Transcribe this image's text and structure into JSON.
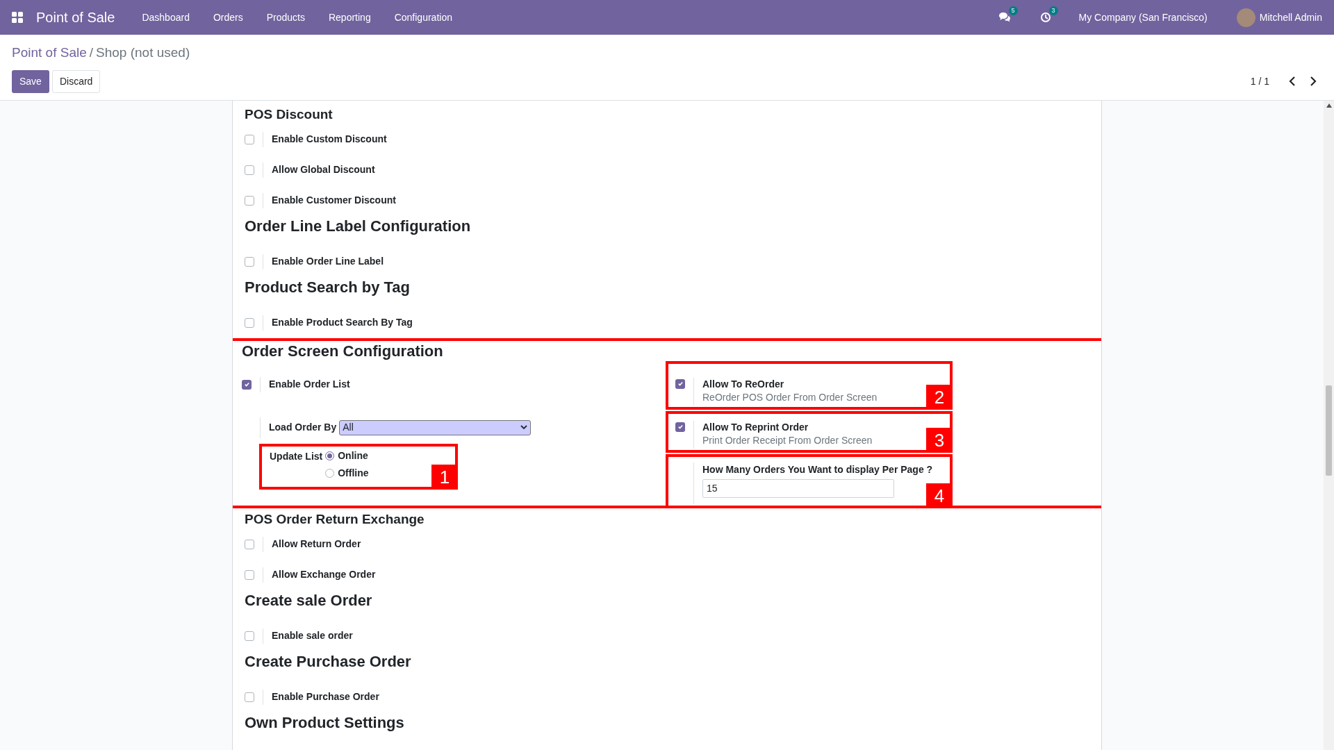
{
  "navbar": {
    "app_name": "Point of Sale",
    "menu": [
      "Dashboard",
      "Orders",
      "Products",
      "Reporting",
      "Configuration"
    ],
    "messages_count": "5",
    "activities_count": "3",
    "company": "My Company (San Francisco)",
    "user": "Mitchell Admin"
  },
  "breadcrumb": {
    "parent": "Point of Sale",
    "separator": "/",
    "current": "Shop (not used)"
  },
  "buttons": {
    "save": "Save",
    "discard": "Discard"
  },
  "pager": "1 / 1",
  "sections": [
    {
      "kind": "subsection",
      "title": "POS Discount",
      "options": [
        {
          "label": "Enable Custom Discount",
          "checked": false
        },
        {
          "label": "Allow Global Discount",
          "checked": false
        },
        {
          "label": "Enable Customer Discount",
          "checked": false
        }
      ]
    },
    {
      "kind": "section",
      "title": "Order Line Label Configuration",
      "options": [
        {
          "label": "Enable Order Line Label",
          "checked": false
        }
      ]
    },
    {
      "kind": "section",
      "title": "Product Search by Tag",
      "options": [
        {
          "label": "Enable Product Search By Tag",
          "checked": false
        }
      ]
    },
    {
      "kind": "order_screen",
      "title": "Order Screen Configuration",
      "enable_order_list": {
        "label": "Enable Order List",
        "checked": true
      },
      "load_order_by": {
        "label": "Load Order By",
        "value": "All"
      },
      "update_list": {
        "label": "Update List",
        "options": [
          {
            "label": "Online",
            "selected": true
          },
          {
            "label": "Offline",
            "selected": false
          }
        ],
        "annotation": "1"
      },
      "reorder": {
        "label": "Allow To ReOrder",
        "help": "ReOrder POS Order From Order Screen",
        "checked": true,
        "annotation": "2"
      },
      "reprint": {
        "label": "Allow To Reprint Order",
        "help": "Print Order Receipt From Order Screen",
        "checked": true,
        "annotation": "3"
      },
      "per_page": {
        "label": "How Many Orders You Want to display Per Page ?",
        "value": "15",
        "annotation": "4"
      }
    },
    {
      "kind": "subsection",
      "title": "POS Order Return Exchange",
      "options": [
        {
          "label": "Allow Return Order",
          "checked": false
        },
        {
          "label": "Allow Exchange Order",
          "checked": false
        }
      ]
    },
    {
      "kind": "section",
      "title": "Create sale Order",
      "options": [
        {
          "label": "Enable sale order",
          "checked": false
        }
      ]
    },
    {
      "kind": "section",
      "title": "Create Purchase Order",
      "options": [
        {
          "label": "Enable Purchase Order",
          "checked": false
        }
      ]
    },
    {
      "kind": "section",
      "title": "Own Product Settings"
    }
  ]
}
